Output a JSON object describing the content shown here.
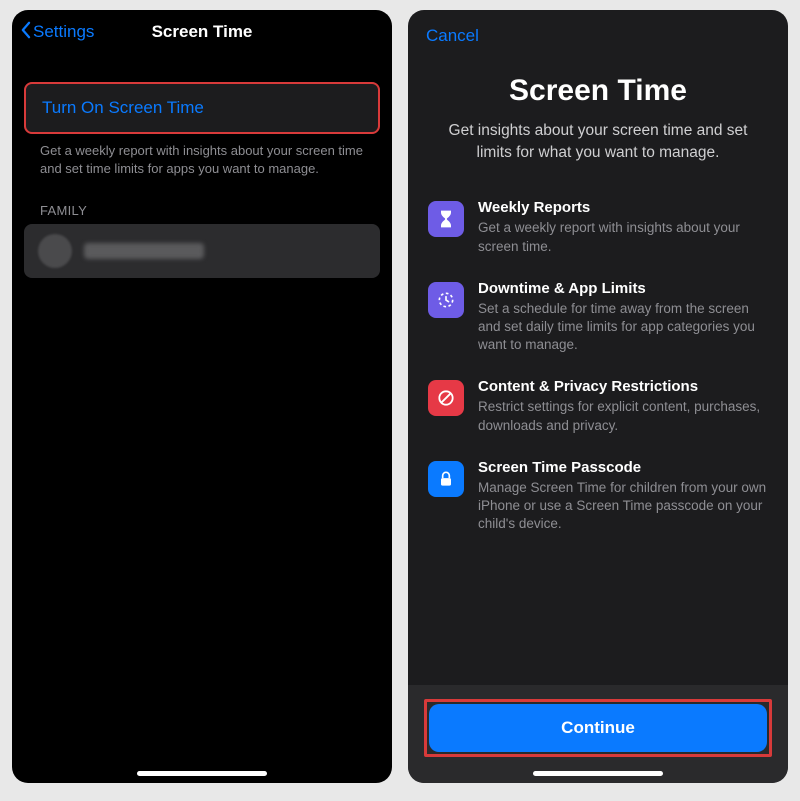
{
  "left": {
    "back_label": "Settings",
    "title": "Screen Time",
    "turn_on": "Turn On Screen Time",
    "description": "Get a weekly report with insights about your screen time and set time limits for apps you want to manage.",
    "family_section": "FAMILY"
  },
  "right": {
    "cancel": "Cancel",
    "title": "Screen Time",
    "subtitle": "Get insights about your screen time and set limits for what you want to manage.",
    "features": [
      {
        "title": "Weekly Reports",
        "desc": "Get a weekly report with insights about your screen time."
      },
      {
        "title": "Downtime & App Limits",
        "desc": "Set a schedule for time away from the screen and set daily time limits for app categories you want to manage."
      },
      {
        "title": "Content & Privacy Restrictions",
        "desc": "Restrict settings for explicit content, purchases, downloads and privacy."
      },
      {
        "title": "Screen Time Passcode",
        "desc": "Manage Screen Time for children from your own iPhone or use a Screen Time passcode on your child's device."
      }
    ],
    "continue": "Continue"
  }
}
